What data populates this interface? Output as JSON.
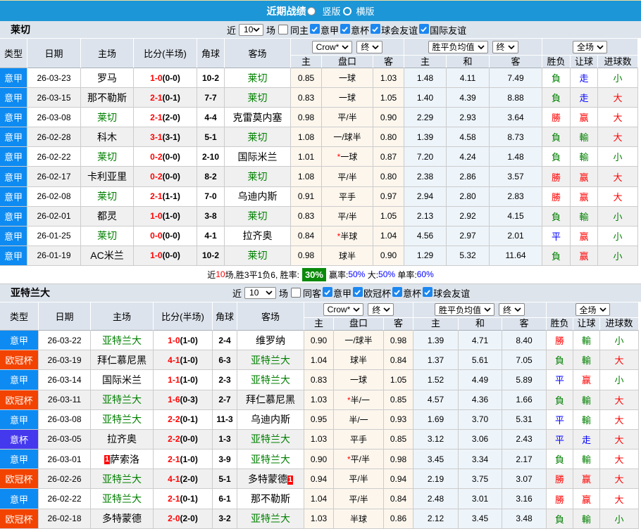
{
  "title_bar": {
    "title": "近期战绩",
    "vertical_label": "竖版",
    "horizontal_label": "横版",
    "vertical_selected": true
  },
  "header_selects": {
    "bookmaker": "Crow*",
    "ah_period": "终",
    "europe_source": "胜平负均值",
    "europe_period": "终",
    "scope": "全场"
  },
  "columns": {
    "left": [
      "类型",
      "日期",
      "主场",
      "比分(半场)",
      "角球",
      "客场"
    ],
    "sub": [
      "主",
      "盘口",
      "客",
      "主",
      "和",
      "客",
      "胜负",
      "让球",
      "进球数"
    ]
  },
  "league_colors": {
    "意甲": "#0D8BF2",
    "欧冠杯": "#F24300",
    "意杯": "#4539EE"
  },
  "char_colors": {
    "勝": "red",
    "負": "green",
    "平": "blue",
    "赢": "red",
    "輸": "green",
    "走": "blue",
    "大": "red",
    "小": "green"
  },
  "colors": {
    "title_bar_blue": "#1C96D6",
    "focus_team_green": "#008000",
    "score_red": "#FF0000",
    "win_rate_badge_green": "#0A8A0A",
    "rate_value_blue": "#0000FF"
  },
  "sections": [
    {
      "team": "莱切",
      "filter": {
        "near": "近",
        "count": "10",
        "games": "场",
        "same": "同主",
        "same_checked": false,
        "leagues": [
          {
            "label": "意甲",
            "checked": true
          },
          {
            "label": "意杯",
            "checked": true
          },
          {
            "label": "球会友谊",
            "checked": true
          },
          {
            "label": "国际友谊",
            "checked": true
          }
        ]
      },
      "rows": [
        {
          "lg": "意甲",
          "date": "26-03-23",
          "home": "罗马",
          "hf": false,
          "score": "1-0",
          "half": "(0-0)",
          "corner": "10-2",
          "away": "莱切",
          "af": true,
          "ah": [
            "0.85",
            "一球",
            "1.03"
          ],
          "st": false,
          "od": [
            "1.48",
            "4.11",
            "7.49"
          ],
          "res": [
            "負",
            "走",
            "小"
          ]
        },
        {
          "lg": "意甲",
          "date": "26-03-15",
          "home": "那不勒斯",
          "hf": false,
          "score": "2-1",
          "half": "(0-1)",
          "corner": "7-7",
          "away": "莱切",
          "af": true,
          "ah": [
            "0.83",
            "一球",
            "1.05"
          ],
          "st": false,
          "od": [
            "1.40",
            "4.39",
            "8.88"
          ],
          "res": [
            "負",
            "走",
            "大"
          ]
        },
        {
          "lg": "意甲",
          "date": "26-03-08",
          "home": "莱切",
          "hf": true,
          "score": "2-1",
          "half": "(2-0)",
          "corner": "4-4",
          "away": "克雷莫内塞",
          "af": false,
          "ah": [
            "0.98",
            "平/半",
            "0.90"
          ],
          "st": false,
          "od": [
            "2.29",
            "2.93",
            "3.64"
          ],
          "res": [
            "勝",
            "赢",
            "大"
          ]
        },
        {
          "lg": "意甲",
          "date": "26-02-28",
          "home": "科木",
          "hf": false,
          "score": "3-1",
          "half": "(3-1)",
          "corner": "5-1",
          "away": "莱切",
          "af": true,
          "ah": [
            "1.08",
            "一/球半",
            "0.80"
          ],
          "st": false,
          "od": [
            "1.39",
            "4.58",
            "8.73"
          ],
          "res": [
            "負",
            "輸",
            "大"
          ]
        },
        {
          "lg": "意甲",
          "date": "26-02-22",
          "home": "莱切",
          "hf": true,
          "score": "0-2",
          "half": "(0-0)",
          "corner": "2-10",
          "away": "国际米兰",
          "af": false,
          "ah": [
            "1.01",
            "一球",
            "0.87"
          ],
          "st": true,
          "od": [
            "7.20",
            "4.24",
            "1.48"
          ],
          "res": [
            "負",
            "輸",
            "小"
          ]
        },
        {
          "lg": "意甲",
          "date": "26-02-17",
          "home": "卡利亚里",
          "hf": false,
          "score": "0-2",
          "half": "(0-0)",
          "corner": "8-2",
          "away": "莱切",
          "af": true,
          "ah": [
            "1.08",
            "平/半",
            "0.80"
          ],
          "st": false,
          "od": [
            "2.38",
            "2.86",
            "3.57"
          ],
          "res": [
            "勝",
            "赢",
            "大"
          ]
        },
        {
          "lg": "意甲",
          "date": "26-02-08",
          "home": "莱切",
          "hf": true,
          "score": "2-1",
          "half": "(1-1)",
          "corner": "7-0",
          "away": "乌迪内斯",
          "af": false,
          "ah": [
            "0.91",
            "平手",
            "0.97"
          ],
          "st": false,
          "od": [
            "2.94",
            "2.80",
            "2.83"
          ],
          "res": [
            "勝",
            "赢",
            "大"
          ]
        },
        {
          "lg": "意甲",
          "date": "26-02-01",
          "home": "都灵",
          "hf": false,
          "score": "1-0",
          "half": "(1-0)",
          "corner": "3-8",
          "away": "莱切",
          "af": true,
          "ah": [
            "0.83",
            "平/半",
            "1.05"
          ],
          "st": false,
          "od": [
            "2.13",
            "2.92",
            "4.15"
          ],
          "res": [
            "負",
            "輸",
            "小"
          ]
        },
        {
          "lg": "意甲",
          "date": "26-01-25",
          "home": "莱切",
          "hf": true,
          "score": "0-0",
          "half": "(0-0)",
          "corner": "4-1",
          "away": "拉齐奥",
          "af": false,
          "ah": [
            "0.84",
            "半球",
            "1.04"
          ],
          "st": true,
          "od": [
            "4.56",
            "2.97",
            "2.01"
          ],
          "res": [
            "平",
            "赢",
            "小"
          ]
        },
        {
          "lg": "意甲",
          "date": "26-01-19",
          "home": "AC米兰",
          "hf": false,
          "score": "1-0",
          "half": "(0-0)",
          "corner": "10-2",
          "away": "莱切",
          "af": true,
          "ah": [
            "0.98",
            "球半",
            "0.90"
          ],
          "st": false,
          "od": [
            "1.29",
            "5.32",
            "11.64"
          ],
          "res": [
            "負",
            "赢",
            "小"
          ]
        }
      ],
      "summary": {
        "parts": [
          {
            "t": "近"
          },
          {
            "t": "10",
            "c": "red"
          },
          {
            "t": "场,胜3平1负6, 胜率:"
          },
          {
            "pct": "30%"
          },
          {
            "t": "赢率:"
          },
          {
            "t": "50%",
            "c": "blue"
          },
          {
            "t": " 大:"
          },
          {
            "t": "50%",
            "c": "blue"
          },
          {
            "t": " 单率:"
          },
          {
            "t": "60%",
            "c": "blue"
          }
        ]
      }
    },
    {
      "team": "亚特兰大",
      "filter": {
        "near": "近",
        "count": "10",
        "games": "场",
        "same": "同客",
        "same_checked": false,
        "leagues": [
          {
            "label": "意甲",
            "checked": true
          },
          {
            "label": "欧冠杯",
            "checked": true
          },
          {
            "label": "意杯",
            "checked": true
          },
          {
            "label": "球会友谊",
            "checked": true
          }
        ]
      },
      "rows": [
        {
          "lg": "意甲",
          "date": "26-03-22",
          "home": "亚特兰大",
          "hf": true,
          "score": "1-0",
          "half": "(1-0)",
          "corner": "2-4",
          "away": "维罗纳",
          "af": false,
          "ah": [
            "0.90",
            "一/球半",
            "0.98"
          ],
          "st": false,
          "od": [
            "1.39",
            "4.71",
            "8.40"
          ],
          "res": [
            "勝",
            "輸",
            "小"
          ]
        },
        {
          "lg": "欧冠杯",
          "date": "26-03-19",
          "home": "拜仁慕尼黑",
          "hf": false,
          "score": "4-1",
          "half": "(1-0)",
          "corner": "6-3",
          "away": "亚特兰大",
          "af": true,
          "ah": [
            "1.04",
            "球半",
            "0.84"
          ],
          "st": false,
          "od": [
            "1.37",
            "5.61",
            "7.05"
          ],
          "res": [
            "負",
            "輸",
            "大"
          ]
        },
        {
          "lg": "意甲",
          "date": "26-03-14",
          "home": "国际米兰",
          "hf": false,
          "score": "1-1",
          "half": "(1-0)",
          "corner": "2-3",
          "away": "亚特兰大",
          "af": true,
          "ah": [
            "0.83",
            "一球",
            "1.05"
          ],
          "st": false,
          "od": [
            "1.52",
            "4.49",
            "5.89"
          ],
          "res": [
            "平",
            "赢",
            "小"
          ]
        },
        {
          "lg": "欧冠杯",
          "date": "26-03-11",
          "home": "亚特兰大",
          "hf": true,
          "score": "1-6",
          "half": "(0-3)",
          "corner": "2-7",
          "away": "拜仁慕尼黑",
          "af": false,
          "ah": [
            "1.03",
            "半/一",
            "0.85"
          ],
          "st": true,
          "od": [
            "4.57",
            "4.36",
            "1.66"
          ],
          "res": [
            "負",
            "輸",
            "大"
          ]
        },
        {
          "lg": "意甲",
          "date": "26-03-08",
          "home": "亚特兰大",
          "hf": true,
          "score": "2-2",
          "half": "(0-1)",
          "corner": "11-3",
          "away": "乌迪内斯",
          "af": false,
          "ah": [
            "0.95",
            "半/一",
            "0.93"
          ],
          "st": false,
          "od": [
            "1.69",
            "3.70",
            "5.31"
          ],
          "res": [
            "平",
            "輸",
            "大"
          ]
        },
        {
          "lg": "意杯",
          "date": "26-03-05",
          "home": "拉齐奥",
          "hf": false,
          "score": "2-2",
          "half": "(0-0)",
          "corner": "1-3",
          "away": "亚特兰大",
          "af": true,
          "ah": [
            "1.03",
            "平手",
            "0.85"
          ],
          "st": false,
          "od": [
            "3.12",
            "3.06",
            "2.43"
          ],
          "res": [
            "平",
            "走",
            "大"
          ]
        },
        {
          "lg": "意甲",
          "date": "26-03-01",
          "home": "萨索洛",
          "hf": false,
          "score": "2-1",
          "half": "(1-0)",
          "corner": "3-9",
          "away": "亚特兰大",
          "af": true,
          "ah": [
            "0.90",
            "平/半",
            "0.98"
          ],
          "st": true,
          "od": [
            "3.45",
            "3.34",
            "2.17"
          ],
          "res": [
            "負",
            "輸",
            "大"
          ],
          "hcard": "1"
        },
        {
          "lg": "欧冠杯",
          "date": "26-02-26",
          "home": "亚特兰大",
          "hf": true,
          "score": "4-1",
          "half": "(2-0)",
          "corner": "5-1",
          "away": "多特蒙德",
          "af": false,
          "ah": [
            "0.94",
            "平/半",
            "0.94"
          ],
          "st": false,
          "od": [
            "2.19",
            "3.75",
            "3.07"
          ],
          "res": [
            "勝",
            "赢",
            "大"
          ],
          "acard": "1"
        },
        {
          "lg": "意甲",
          "date": "26-02-22",
          "home": "亚特兰大",
          "hf": true,
          "score": "2-1",
          "half": "(0-1)",
          "corner": "6-1",
          "away": "那不勒斯",
          "af": false,
          "ah": [
            "1.04",
            "平/半",
            "0.84"
          ],
          "st": false,
          "od": [
            "2.48",
            "3.01",
            "3.16"
          ],
          "res": [
            "勝",
            "赢",
            "大"
          ]
        },
        {
          "lg": "欧冠杯",
          "date": "26-02-18",
          "home": "多特蒙德",
          "hf": false,
          "score": "2-0",
          "half": "(2-0)",
          "corner": "3-2",
          "away": "亚特兰大",
          "af": true,
          "ah": [
            "1.03",
            "半球",
            "0.86"
          ],
          "st": false,
          "od": [
            "2.12",
            "3.45",
            "3.48"
          ],
          "res": [
            "負",
            "輸",
            "小"
          ]
        }
      ],
      "summary": null
    }
  ]
}
